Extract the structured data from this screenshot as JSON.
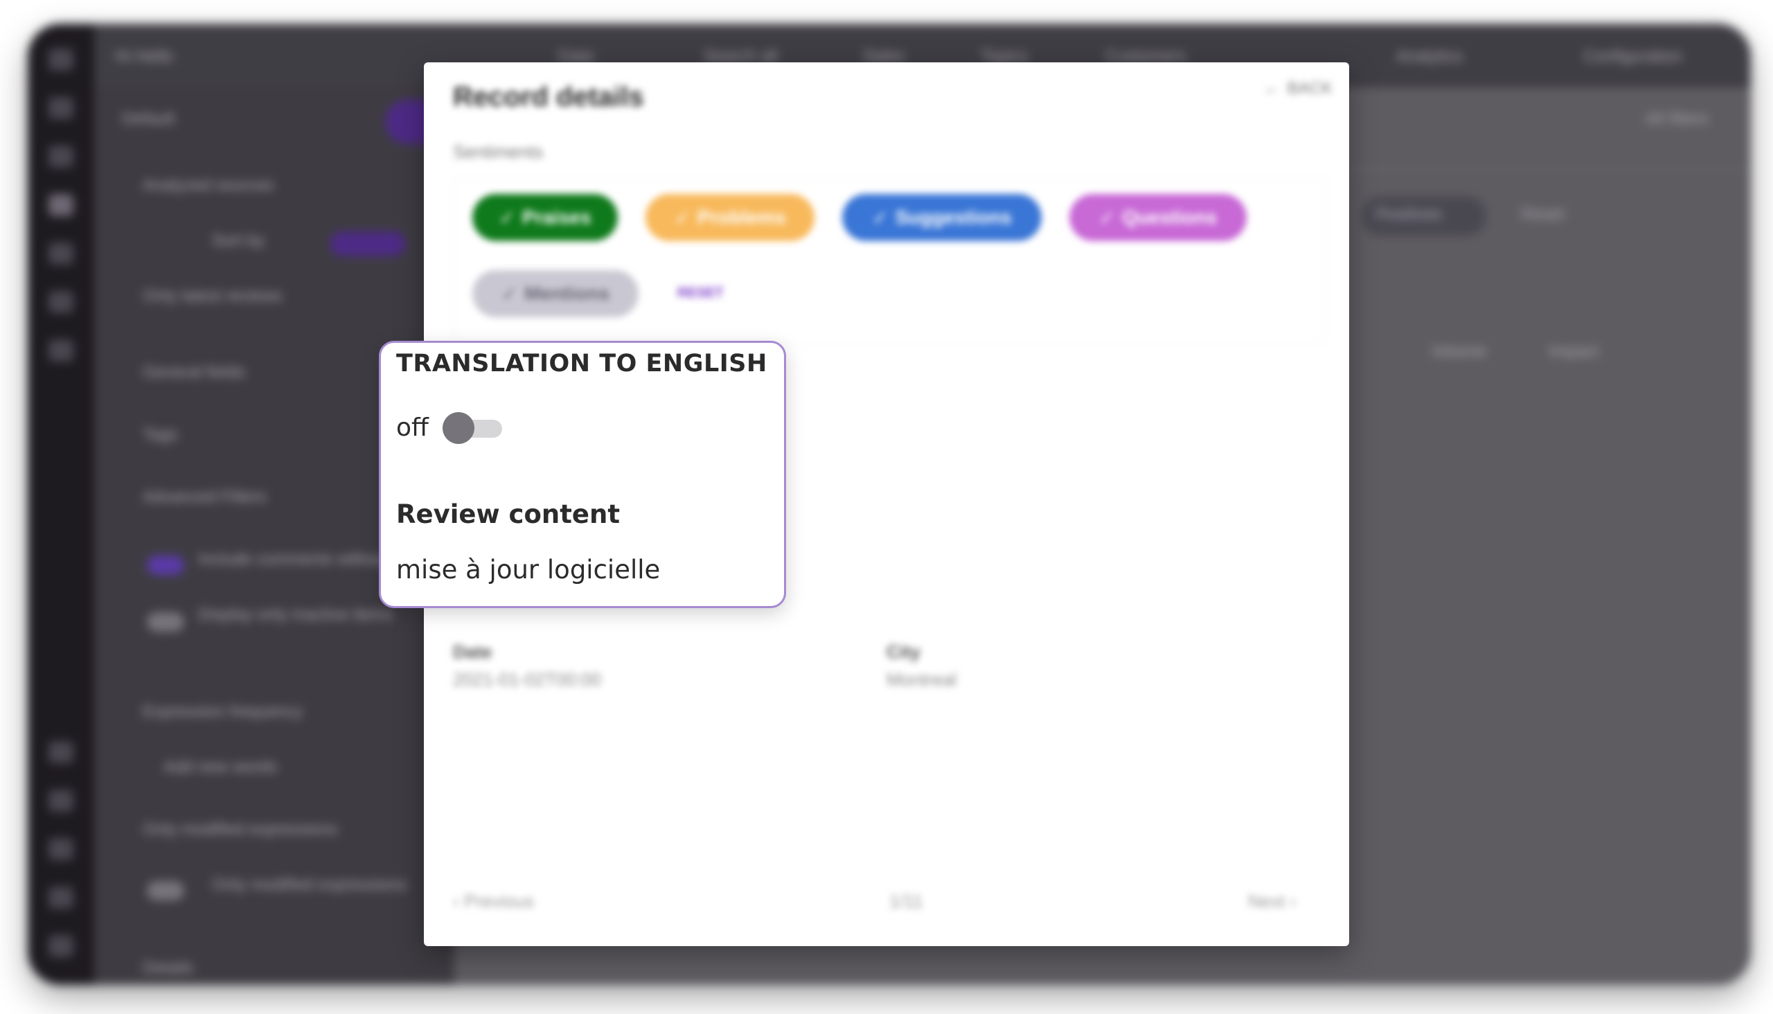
{
  "background": {
    "workspace_label": "Hi Hello",
    "filter_label": "Default",
    "side_items": [
      "Analyzed sources",
      "Sort by",
      "Only latest reviews",
      "General fields",
      "Tags",
      "Advanced Filters",
      "Include comments without topics",
      "Display only inactive items",
      "Expression frequency",
      "Add new words",
      "Only modified expressions",
      "Only modified expressions",
      "Details"
    ],
    "topbar_items": [
      "Data",
      "Search all",
      "Sales",
      "Topics",
      "Customers",
      "Analytics",
      "Configuration"
    ],
    "right_items": [
      "All filters",
      "Positives",
      "Reset"
    ],
    "table_headers": [
      "Volume",
      "Impact"
    ]
  },
  "modal": {
    "title": "Record details",
    "back_label": "BACK",
    "sentiments_label": "Sentiments",
    "chips": [
      {
        "label": "Praises",
        "bg": "#0f7a1c",
        "fg": "#ffffff"
      },
      {
        "label": "Problems",
        "bg": "#f8b95c",
        "fg": "#ffffff"
      },
      {
        "label": "Suggestions",
        "bg": "#3a76d6",
        "fg": "#ffffff"
      },
      {
        "label": "Questions",
        "bg": "#c869d6",
        "fg": "#ffffff"
      },
      {
        "label": "Mentions",
        "bg": "#c9c8d2",
        "fg": "#6a6876"
      }
    ],
    "reset_label": "RESET",
    "fields": [
      {
        "label": "Date",
        "value": "2021-01-02T00:00"
      },
      {
        "label": "City",
        "value": "Montreal"
      }
    ],
    "previous_label": "Previous",
    "page_indicator": "1/11",
    "next_label": "Next"
  },
  "tooltip": {
    "heading": "TRANSLATION TO ENGLISH",
    "toggle_state": "off",
    "subheading": "Review content",
    "content": "mise à jour logicielle"
  }
}
